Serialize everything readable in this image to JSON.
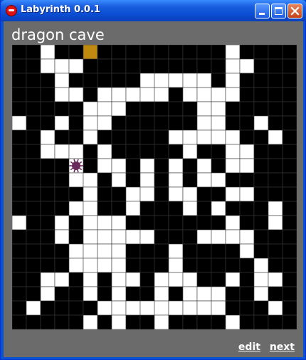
{
  "window": {
    "title": "Labyrinth  0.0.1",
    "controls": [
      "minimize",
      "maximize",
      "close"
    ]
  },
  "level": {
    "name": "dragon cave"
  },
  "maze": {
    "columns": 20,
    "rows": 20,
    "legend": {
      "#": "wall",
      ".": "path",
      "S": "start",
      "E": "exit",
      "P": "player"
    },
    "grid": [
      "##.##S#########.####",
      "##...##########..###",
      "###.#####.....#.####",
      "###..#.....#....####",
      "#####...#####..#####",
      ".##.#..######..##.##",
      "##.##.#####.....##.#",
      "##...#.#####.##..###",
      "####P#..#.#.#.#..###",
      "####..#.#.#.#..#####",
      "#####.##..#..##..###",
      "####..##.###.#.###.#",
      ".##.#...#######.##.#",
      "###.#.....###....###",
      "####....###.####.###",
      "####....###.#####.##",
      "##..#.#..#...##.#..#",
      "##.##.#.##.#...##.##",
      "#.####.........###.#",
      "#####.#.##.####.####"
    ],
    "exit_color": "#c08a10",
    "path_color": "#ffffff",
    "wall_color": "#000000",
    "player_color": "#6a2a5a"
  },
  "footer": {
    "edit_label": "edit",
    "next_label": "next"
  }
}
